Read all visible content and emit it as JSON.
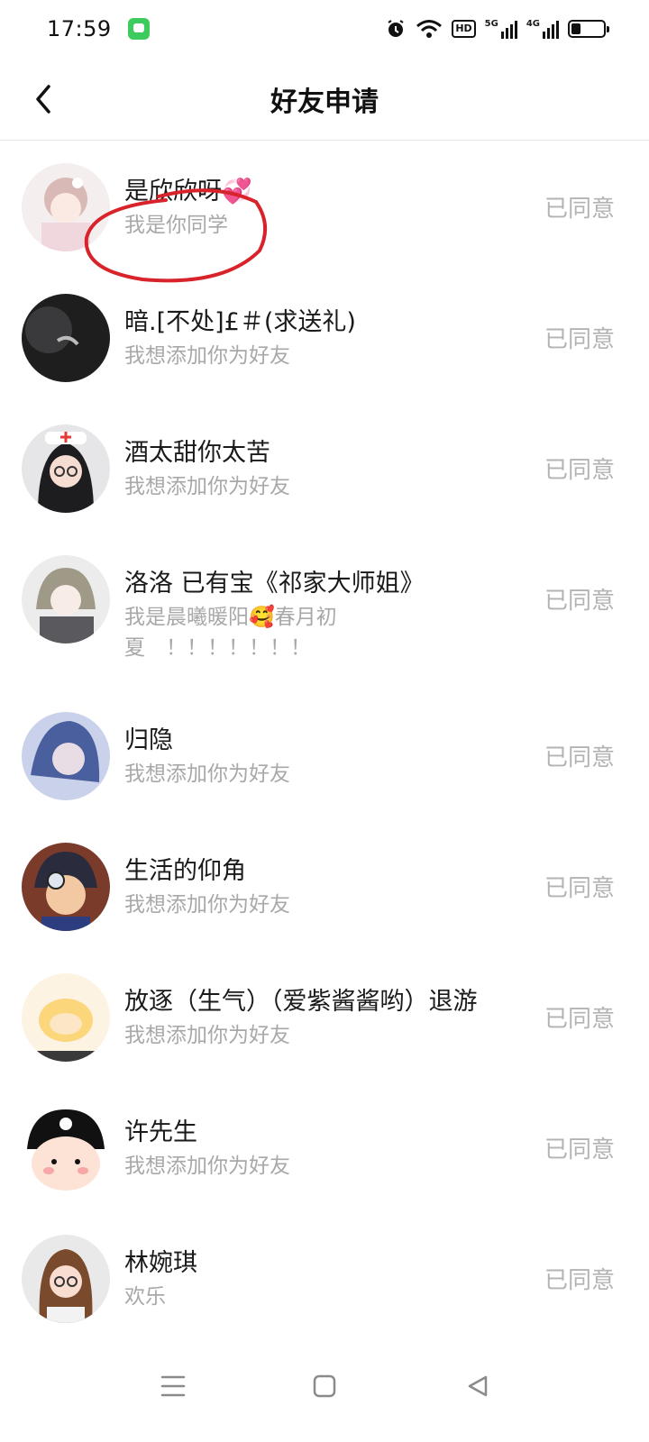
{
  "status_bar": {
    "time": "17:59",
    "hd_label": "HD",
    "net1": "5G",
    "net2": "4G"
  },
  "header": {
    "title": "好友申请"
  },
  "requests": [
    {
      "name": "是欣欣呀💞",
      "message": "我是你同学",
      "status": "已同意"
    },
    {
      "name": "暗.[不处]£＃(求送礼)",
      "message": "我想添加你为好友",
      "status": "已同意"
    },
    {
      "name": "酒太甜你太苦",
      "message": "我想添加你为好友",
      "status": "已同意"
    },
    {
      "name": "洛洛 已有宝《祁家大师姐》",
      "message": "我是晨曦暖阳🥰春月初夏　！！！！！！！",
      "status": "已同意"
    },
    {
      "name": "归隐",
      "message": "我想添加你为好友",
      "status": "已同意"
    },
    {
      "name": "生活的仰角",
      "message": "我想添加你为好友",
      "status": "已同意"
    },
    {
      "name": "放逐（生气）（爱紫酱酱哟）退游",
      "message": "我想添加你为好友",
      "status": "已同意"
    },
    {
      "name": "许先生",
      "message": "我想添加你为好友",
      "status": "已同意"
    },
    {
      "name": "林婉琪",
      "message": "欢乐",
      "status": "已同意"
    }
  ],
  "annotation_color": "#d8232a"
}
